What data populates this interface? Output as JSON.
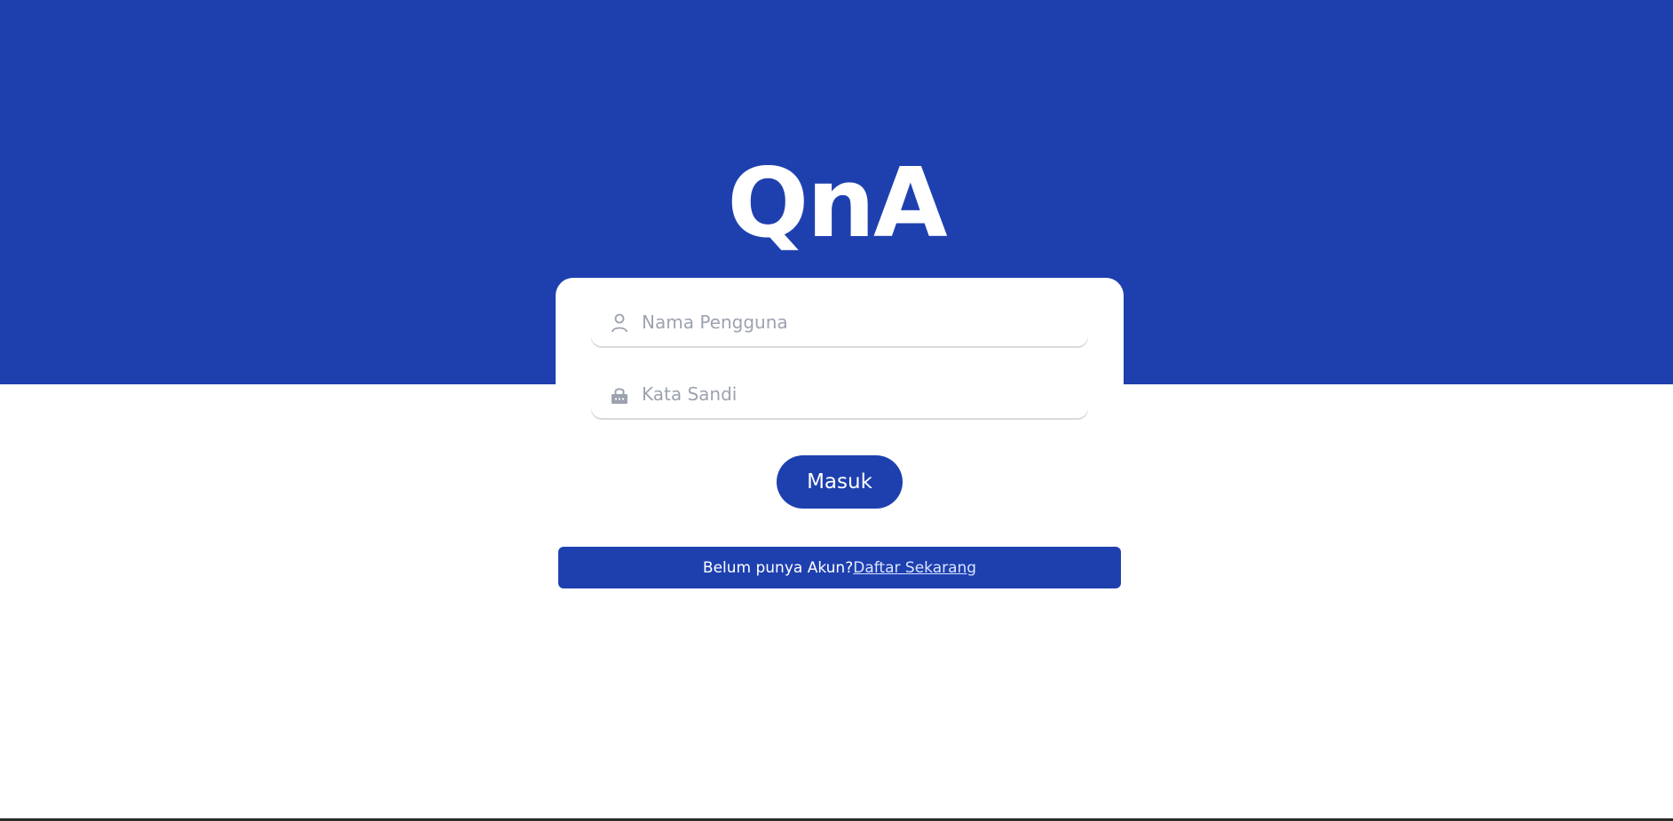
{
  "brand": {
    "title": "QnA"
  },
  "login_form": {
    "username": {
      "placeholder": "Nama Pengguna",
      "value": "",
      "icon": "user-icon"
    },
    "password": {
      "placeholder": "Kata Sandi",
      "value": "",
      "icon": "lock-icon"
    },
    "submit_label": "Masuk"
  },
  "register": {
    "prompt": "Belum punya Akun?",
    "link_label": "Daftar Sekarang"
  },
  "colors": {
    "primary": "#1e40af",
    "background": "#ffffff",
    "placeholder": "#9ca3af",
    "link": "#dbe4ff"
  }
}
